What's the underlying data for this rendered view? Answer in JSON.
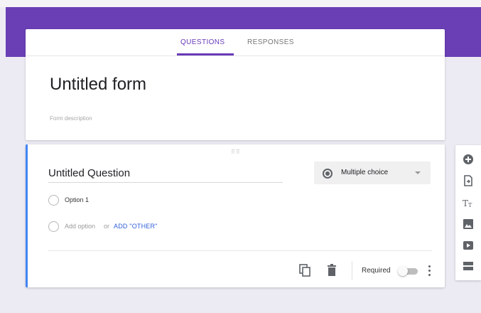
{
  "tabs": [
    {
      "label": "QUESTIONS",
      "active": true
    },
    {
      "label": "RESPONSES",
      "active": false
    }
  ],
  "form": {
    "title": "Untitled form",
    "description_placeholder": "Form description"
  },
  "question": {
    "title": "Untitled Question",
    "type_label": "Multiple choice",
    "options": [
      {
        "label": "Option 1"
      }
    ],
    "add_option_label": "Add option",
    "or_label": "or",
    "add_other_label": "ADD \"OTHER\"",
    "required_label": "Required",
    "required_on": false
  },
  "sidebar": {
    "items": [
      {
        "icon": "add-question-icon"
      },
      {
        "icon": "import-questions-icon"
      },
      {
        "icon": "title-text-icon"
      },
      {
        "icon": "image-icon"
      },
      {
        "icon": "video-icon"
      },
      {
        "icon": "section-icon"
      }
    ]
  },
  "colors": {
    "brand": "#673ab7",
    "header_band": "#6a3fb5",
    "accent": "#4285f4",
    "link": "#2f5ed8",
    "background": "#ecebf3"
  }
}
